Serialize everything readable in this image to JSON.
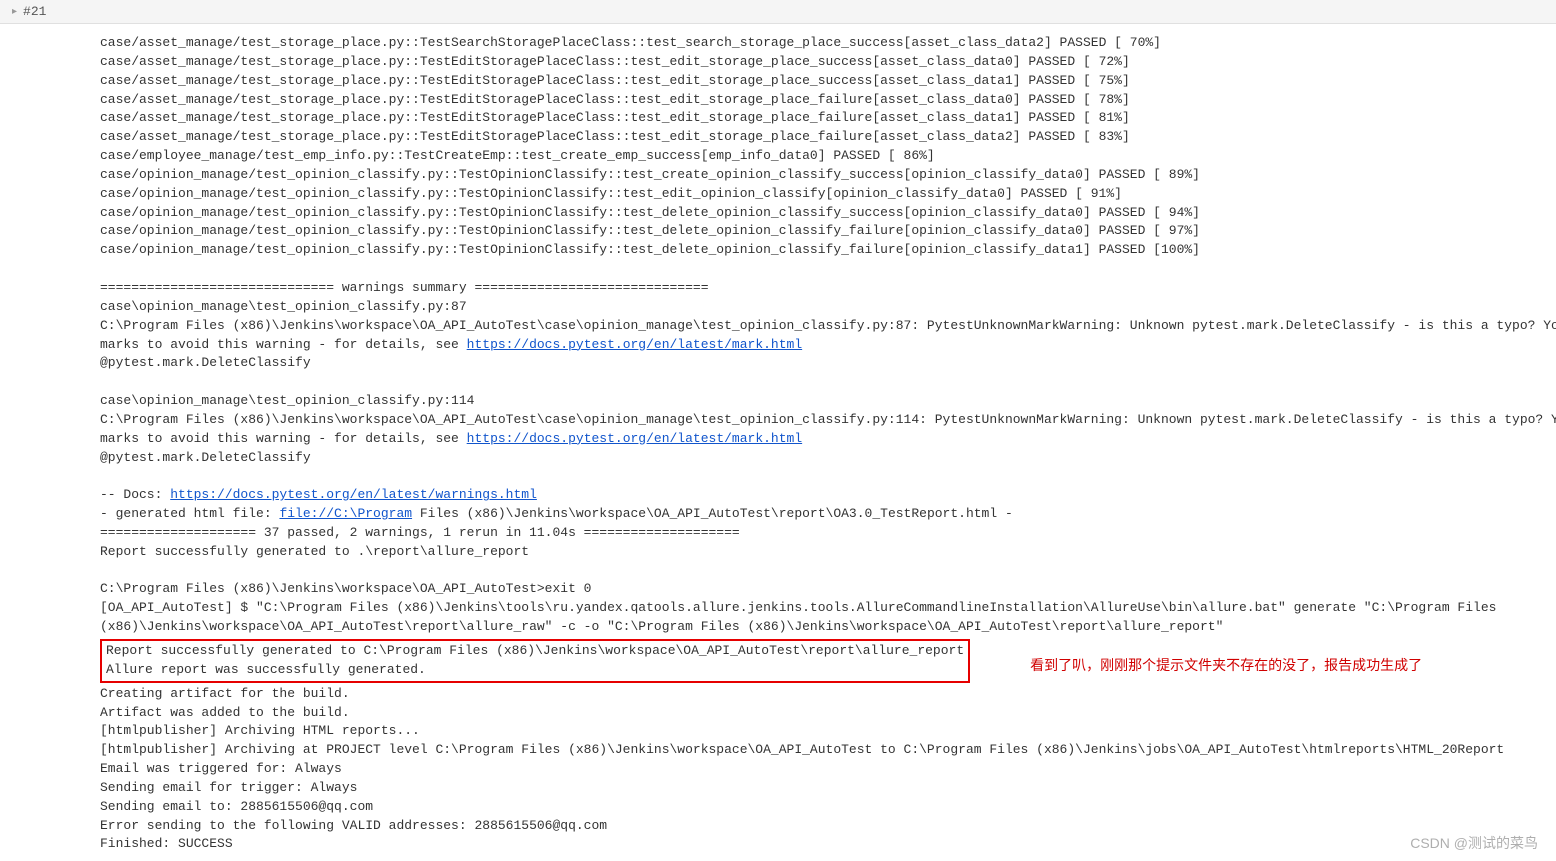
{
  "breadcrumb": {
    "build_label": "#21"
  },
  "console": {
    "test_lines": [
      "case/asset_manage/test_storage_place.py::TestSearchStoragePlaceClass::test_search_storage_place_success[asset_class_data2] PASSED [ 70%]",
      "case/asset_manage/test_storage_place.py::TestEditStoragePlaceClass::test_edit_storage_place_success[asset_class_data0] PASSED [ 72%]",
      "case/asset_manage/test_storage_place.py::TestEditStoragePlaceClass::test_edit_storage_place_success[asset_class_data1] PASSED [ 75%]",
      "case/asset_manage/test_storage_place.py::TestEditStoragePlaceClass::test_edit_storage_place_failure[asset_class_data0] PASSED [ 78%]",
      "case/asset_manage/test_storage_place.py::TestEditStoragePlaceClass::test_edit_storage_place_failure[asset_class_data1] PASSED [ 81%]",
      "case/asset_manage/test_storage_place.py::TestEditStoragePlaceClass::test_edit_storage_place_failure[asset_class_data2] PASSED [ 83%]",
      "case/employee_manage/test_emp_info.py::TestCreateEmp::test_create_emp_success[emp_info_data0] PASSED [ 86%]",
      "case/opinion_manage/test_opinion_classify.py::TestOpinionClassify::test_create_opinion_classify_success[opinion_classify_data0] PASSED [ 89%]",
      "case/opinion_manage/test_opinion_classify.py::TestOpinionClassify::test_edit_opinion_classify[opinion_classify_data0] PASSED [ 91%]",
      "case/opinion_manage/test_opinion_classify.py::TestOpinionClassify::test_delete_opinion_classify_success[opinion_classify_data0] PASSED [ 94%]",
      "case/opinion_manage/test_opinion_classify.py::TestOpinionClassify::test_delete_opinion_classify_failure[opinion_classify_data0] PASSED [ 97%]",
      "case/opinion_manage/test_opinion_classify.py::TestOpinionClassify::test_delete_opinion_classify_failure[opinion_classify_data1] PASSED [100%]"
    ],
    "warnings_header": "============================== warnings summary ==============================",
    "warn1_path": "case\\opinion_manage\\test_opinion_classify.py:87",
    "warn1_body_prefix": "  C:\\Program Files (x86)\\Jenkins\\workspace\\OA_API_AutoTest\\case\\opinion_manage\\test_opinion_classify.py:87: PytestUnknownMarkWarning: Unknown pytest.mark.DeleteClassify - is this a typo?  You can register cu",
    "warn_marks_prefix": "marks to avoid this warning - for details, see ",
    "warn_marks_link": "https://docs.pytest.org/en/latest/mark.html",
    "warn_decorator": "    @pytest.mark.DeleteClassify",
    "warn2_path": "case\\opinion_manage\\test_opinion_classify.py:114",
    "warn2_body_prefix": "  C:\\Program Files (x86)\\Jenkins\\workspace\\OA_API_AutoTest\\case\\opinion_manage\\test_opinion_classify.py:114: PytestUnknownMarkWarning: Unknown pytest.mark.DeleteClassify - is this a typo?  You can register c",
    "docs_prefix": "-- Docs: ",
    "docs_link": "https://docs.pytest.org/en/latest/warnings.html",
    "gen_html_prefix": "- generated html file: ",
    "gen_html_link": "file://C:\\Program",
    "gen_html_suffix": " Files (x86)\\Jenkins\\workspace\\OA_API_AutoTest\\report\\OA3.0_TestReport.html -",
    "summary_line": "==================== 37 passed, 2 warnings, 1 rerun in 11.04s ====================",
    "report_gen1": "Report successfully generated to .\\report\\allure_report",
    "exit_line": "C:\\Program Files (x86)\\Jenkins\\workspace\\OA_API_AutoTest>exit 0",
    "allure_cmd1": "[OA_API_AutoTest] $ \"C:\\Program Files (x86)\\Jenkins\\tools\\ru.yandex.qatools.allure.jenkins.tools.AllureCommandlineInstallation\\AllureUse\\bin\\allure.bat\" generate \"C:\\Program Files",
    "allure_cmd2": "(x86)\\Jenkins\\workspace\\OA_API_AutoTest\\report\\allure_raw\" -c -o \"C:\\Program Files (x86)\\Jenkins\\workspace\\OA_API_AutoTest\\report\\allure_report\"",
    "boxed_line1": "Report successfully generated to C:\\Program Files (x86)\\Jenkins\\workspace\\OA_API_AutoTest\\report\\allure_report",
    "boxed_line2": "Allure report was successfully generated.",
    "annotation_text": "看到了叭，刚刚那个提示文件夹不存在的没了，报告成功生成了",
    "tail_lines": [
      "Creating artifact for the build.",
      "Artifact was added to the build.",
      "[htmlpublisher] Archiving HTML reports...",
      "[htmlpublisher] Archiving at PROJECT level C:\\Program Files (x86)\\Jenkins\\workspace\\OA_API_AutoTest to C:\\Program Files (x86)\\Jenkins\\jobs\\OA_API_AutoTest\\htmlreports\\HTML_20Report",
      "Email was triggered for: Always",
      "Sending email for trigger: Always",
      "Sending email to: 2885615506@qq.com",
      "Error sending to the following VALID addresses: 2885615506@qq.com",
      "Finished: SUCCESS"
    ]
  },
  "watermark": "CSDN @测试的菜鸟"
}
